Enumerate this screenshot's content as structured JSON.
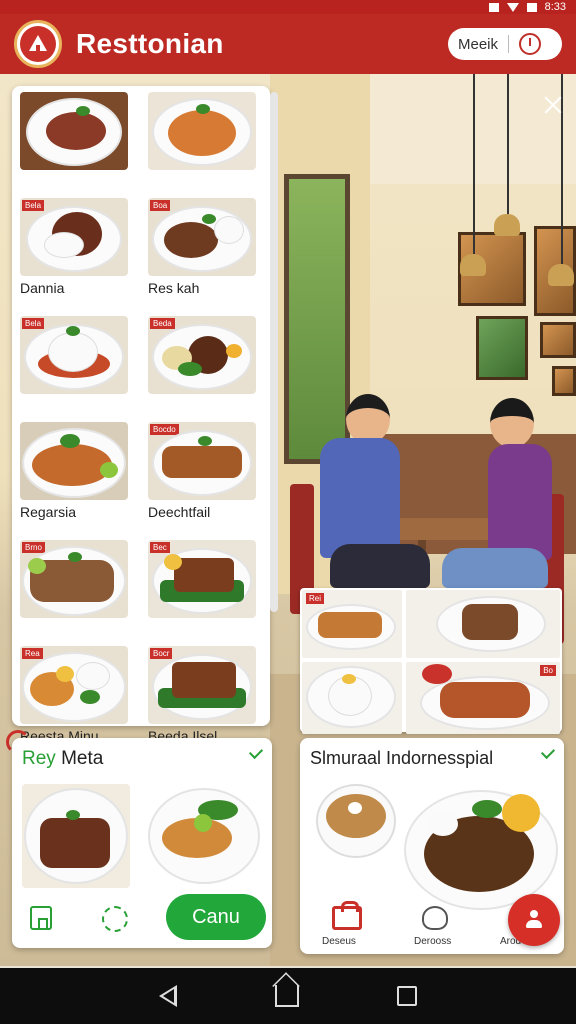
{
  "status_bar": {
    "time": "8:33"
  },
  "header": {
    "title": "Resttonian",
    "pill_label": "Meeik"
  },
  "menu": {
    "items": [
      {
        "label": "",
        "tag": ""
      },
      {
        "label": "",
        "tag": ""
      },
      {
        "label": "Dannia",
        "tag": "Bela"
      },
      {
        "label": "Res kah",
        "tag": "Boa"
      },
      {
        "label": "",
        "tag": "Bela"
      },
      {
        "label": "",
        "tag": "Beda"
      },
      {
        "label": "Regarsia",
        "tag": ""
      },
      {
        "label": "Deechtfail",
        "tag": "Bocdo"
      },
      {
        "label": "",
        "tag": "Brno"
      },
      {
        "label": "",
        "tag": "Bec"
      },
      {
        "label": "Reesta Minu",
        "tag": "Rea"
      },
      {
        "label": "Beeda Ilsel",
        "tag": "Bocr"
      }
    ]
  },
  "collage": {
    "tags": [
      "Rei",
      "",
      "",
      "Bo"
    ]
  },
  "card_left": {
    "title_accent": "Rey",
    "title_rest": " Meta",
    "button_label": "Canu"
  },
  "card_right": {
    "title": "Slmuraal Indornesspial",
    "nav": [
      {
        "label": "Deseus"
      },
      {
        "label": "Derooss"
      },
      {
        "label": "Arod"
      }
    ]
  },
  "colors": {
    "brand_red": "#bd2a24",
    "accent_green": "#22a83a"
  }
}
